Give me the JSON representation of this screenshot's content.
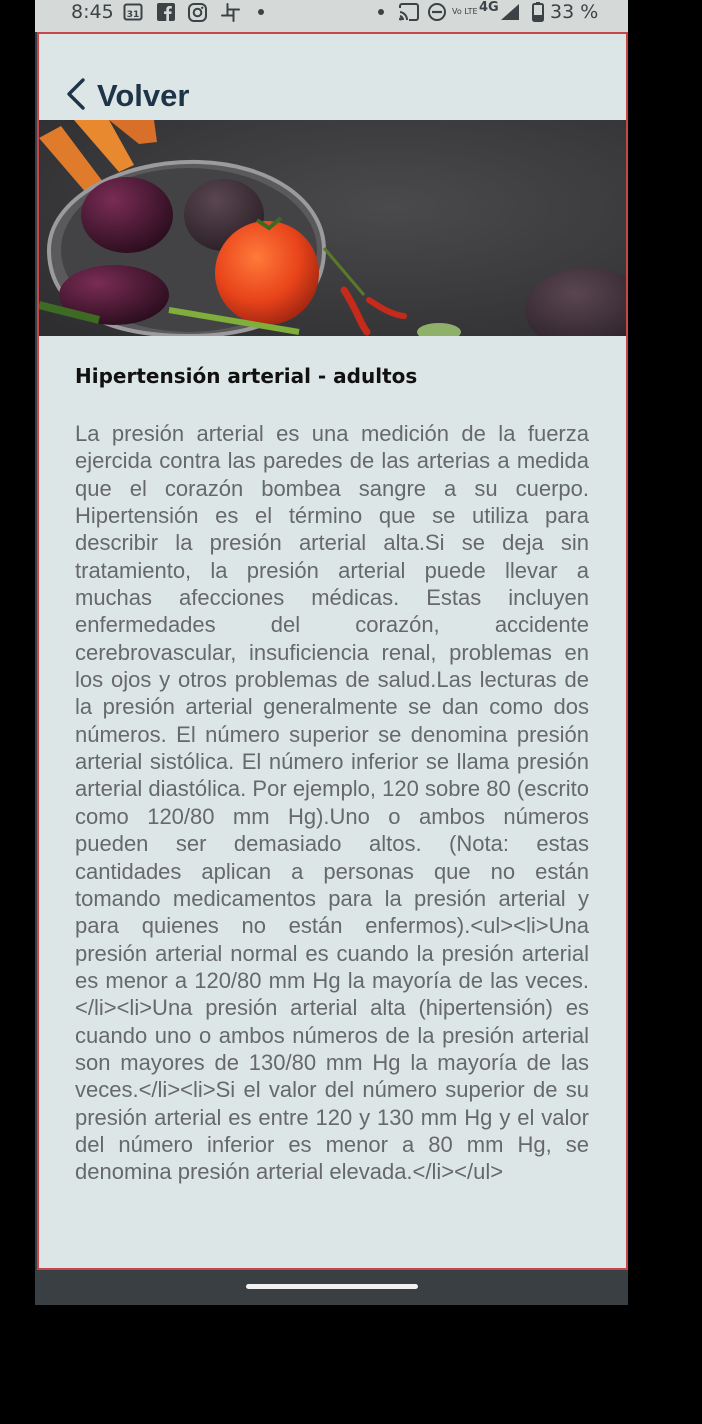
{
  "status_bar": {
    "time": "8:45",
    "calendar_day": "31",
    "network": "4G",
    "volte": "Vo LTE",
    "battery": "33 %",
    "icons": [
      "calendar-icon",
      "facebook-icon",
      "instagram-icon",
      "slack-icon",
      "dot-icon",
      "cast-icon",
      "dnd-icon",
      "volte-icon",
      "signal-icon",
      "battery-icon"
    ]
  },
  "header": {
    "back_label": "Volver"
  },
  "article": {
    "title": "Hipertensión arterial - adultos",
    "body": "La presión arterial es una medición de la fuerza ejercida contra las paredes de las arterias a medida que el corazón bombea sangre a su cuerpo. Hipertensión es el término que se utiliza para describir la presión arterial alta.Si se deja sin tratamiento, la presión arterial puede llevar a muchas afecciones médicas. Estas incluyen enfermedades del corazón, accidente cerebrovascular, insuficiencia renal, problemas en los ojos y otros problemas de salud.Las lecturas de la presión arterial generalmente se dan como dos números. El número superior se denomina presión arterial sistólica. El número inferior se llama presión arterial diastólica. Por ejemplo, 120 sobre 80 (escrito como 120/80 mm Hg).Uno o ambos números pueden ser demasiado altos. (Nota: estas cantidades aplican a personas que no están tomando medicamentos para la presión arterial y para quienes no están enfermos).<ul><li>Una presión arterial normal es cuando la presión arterial es menor a 120/80 mm Hg la mayoría de las veces.</li><li>Una presión arterial alta (hipertensión) es cuando uno o ambos números de la presión arterial son mayores de 130/80 mm Hg la mayoría de las veces.</li><li>Si el valor del número superior de su presión arterial es entre 120 y 130 mm Hg y el valor del número inferior es menor a 80 mm Hg, se denomina presión arterial elevada.</li></ul>"
  },
  "colors": {
    "app_background": "#dde6e6",
    "frame_border": "#c6474b",
    "back_text": "#1e3448",
    "body_text": "#66696c",
    "title_text": "#111111"
  }
}
